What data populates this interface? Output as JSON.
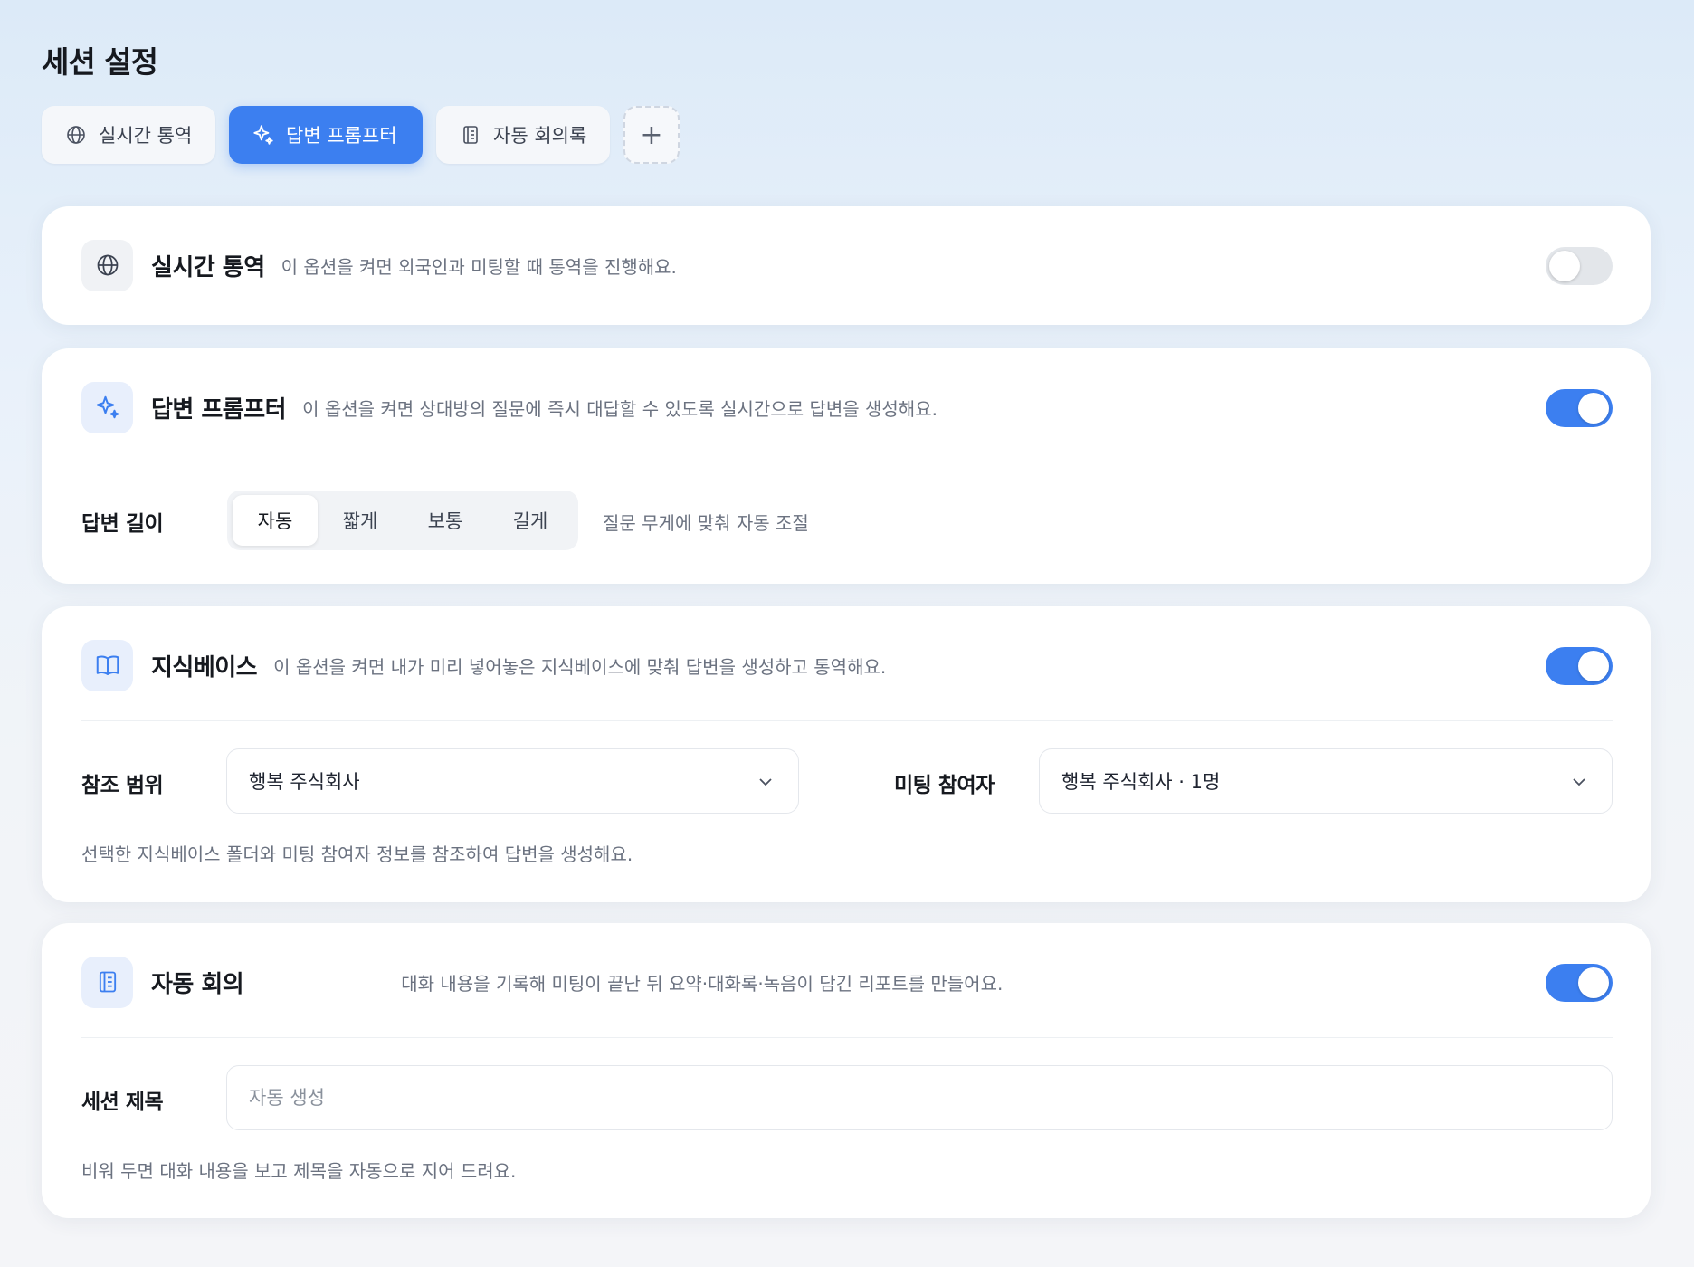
{
  "page": {
    "title": "세션 설정"
  },
  "tabs": [
    {
      "label": "실시간 통역",
      "icon": "globe-icon",
      "active": false
    },
    {
      "label": "답변 프롬프터",
      "icon": "sparkle-icon",
      "active": true
    },
    {
      "label": "자동 회의록",
      "icon": "document-icon",
      "active": false
    }
  ],
  "add_tab": {
    "label": "+"
  },
  "interpret": {
    "title": "실시간 통역",
    "desc": "이 옵션을 켜면 외국인과 미팅할 때 통역을 진행해요.",
    "enabled": false
  },
  "prompter": {
    "title": "답변 프롬프터",
    "desc": "이 옵션을 켜면 상대방의 질문에 즉시 대답할 수 있도록 실시간으로 답변을 생성해요.",
    "enabled": true,
    "length_label": "답변 길이",
    "options": [
      "자동",
      "짧게",
      "보통",
      "길게"
    ],
    "selected": "자동",
    "hint": "질문 무게에 맞춰 자동 조절"
  },
  "knowledge": {
    "title": "지식베이스",
    "desc": "이 옵션을 켜면 내가 미리 넣어놓은 지식베이스에 맞춰 답변을 생성하고 통역해요.",
    "enabled": true,
    "scope_label": "참조 범위",
    "scope_value": "행복 주식회사",
    "participants_label": "미팅 참여자",
    "participants_value": "행복 주식회사 · 1명",
    "hint": "선택한 지식베이스 폴더와 미팅 참여자 정보를 참조하여 답변을 생성해요."
  },
  "minutes": {
    "title": "자동 회의",
    "desc": "대화 내용을 기록해 미팅이 끝난 뒤 요약·대화록·녹음이 담긴 리포트를 만들어요.",
    "enabled": true,
    "session_label": "세션 제목",
    "session_placeholder": "자동 생성",
    "session_value": "",
    "hint": "비워 두면 대화 내용을 보고 제목을 자동으로 지어 드려요."
  },
  "colors": {
    "accent": "#3c7ff0",
    "toggle_off": "#e3e6ea"
  }
}
